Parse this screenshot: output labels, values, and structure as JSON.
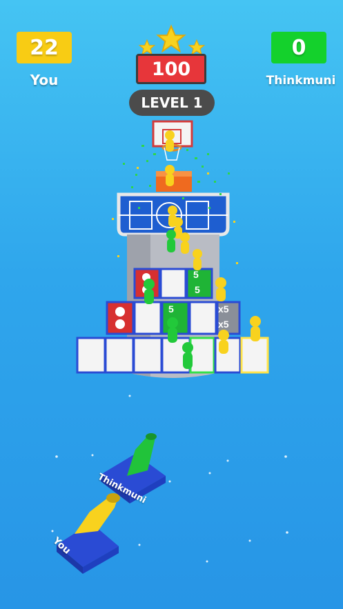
{
  "hud": {
    "player_score": "22",
    "player_name": "You",
    "opponent_score": "0",
    "opponent_name": "Thinkmuni",
    "target_score": "100",
    "level_label": "LEVEL 1",
    "stars": 3
  },
  "board": {
    "tiles": [
      {
        "text": "5"
      },
      {
        "text": "5"
      },
      {
        "text": "5"
      },
      {
        "text": "x5"
      },
      {
        "text": "x5"
      }
    ]
  },
  "cannons": {
    "player_label": "You",
    "opponent_label": "Thinkmuni"
  },
  "colors": {
    "player": "#f8cc14",
    "opponent": "#14d12c",
    "target": "#e7363a",
    "pill": "#4b4b4b"
  }
}
